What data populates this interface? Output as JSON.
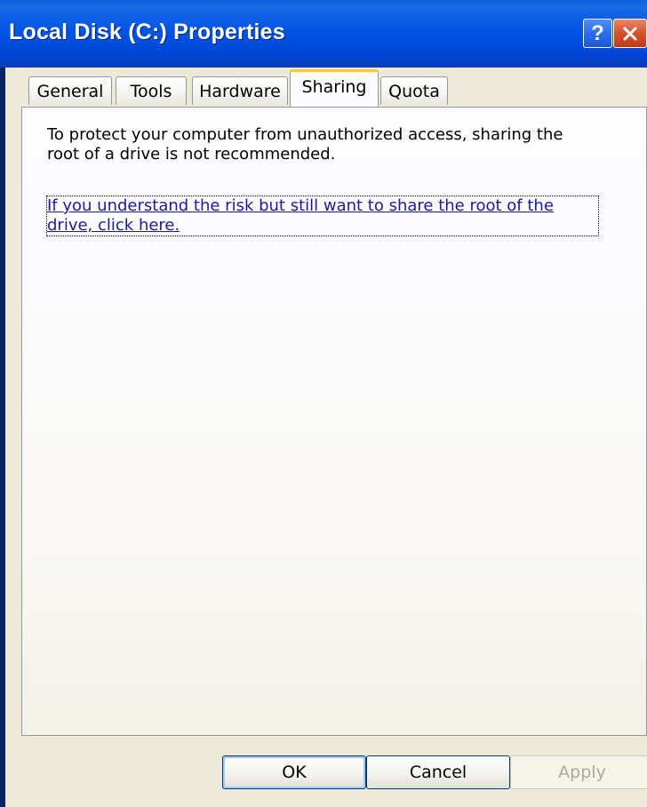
{
  "window": {
    "title": "Local Disk (C:) Properties",
    "help_label": "?",
    "close_icon": "close-x"
  },
  "tabs": [
    {
      "label": "General",
      "active": false
    },
    {
      "label": "Tools",
      "active": false
    },
    {
      "label": "Hardware",
      "active": false
    },
    {
      "label": "Sharing",
      "active": true
    },
    {
      "label": "Quota",
      "active": false
    }
  ],
  "sharing": {
    "warning": "To protect your computer from unauthorized access, sharing the root of a drive is not recommended.",
    "link": "If you understand the risk but still want to share the root of the drive, click here."
  },
  "buttons": {
    "ok": "OK",
    "cancel": "Cancel",
    "apply": "Apply"
  },
  "colors": {
    "titlebar": "#0055e5",
    "active_tab_accent": "#ffc83c",
    "link": "#1a1aa6",
    "disabled_text": "#aca899"
  }
}
